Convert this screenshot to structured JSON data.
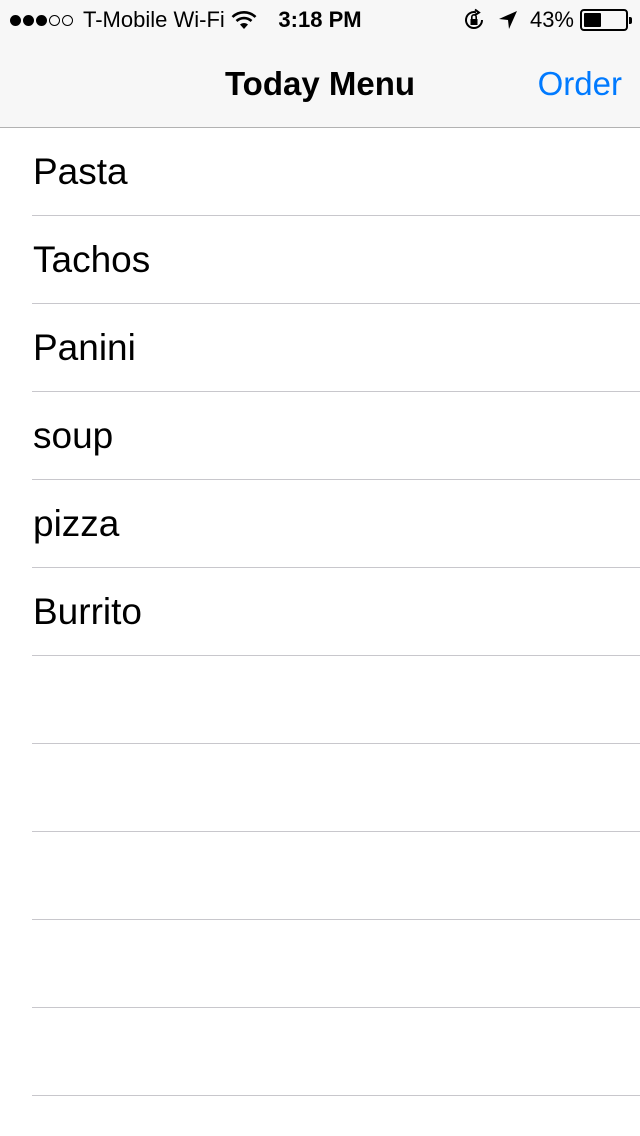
{
  "status_bar": {
    "signal_bars": 3,
    "signal_total": 5,
    "carrier": "T-Mobile Wi-Fi",
    "time": "3:18 PM",
    "battery_percent": "43%",
    "battery_level": 0.43,
    "icons": [
      "wifi-icon",
      "orientation-lock-icon",
      "location-arrow-icon",
      "battery-icon"
    ]
  },
  "nav": {
    "title": "Today Menu",
    "right_button": "Order"
  },
  "menu": {
    "items": [
      "Pasta",
      "Tachos",
      "Panini",
      "soup",
      "pizza",
      "Burrito",
      "",
      "",
      "",
      "",
      "",
      ""
    ]
  },
  "colors": {
    "accent": "#007aff",
    "navbar_bg": "#f7f7f7",
    "separator": "#c8c7cc"
  }
}
